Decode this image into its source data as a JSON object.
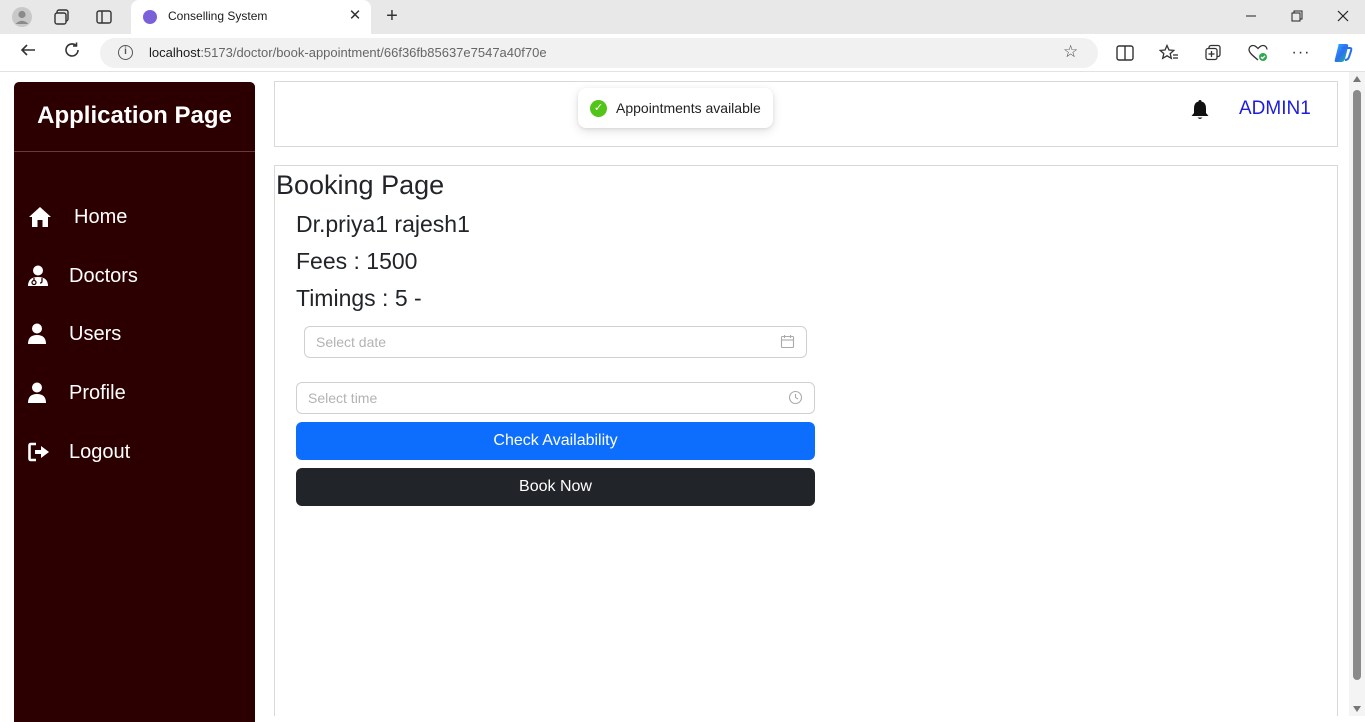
{
  "browser": {
    "tab_title": "Conselling System",
    "url_host": "localhost",
    "url_path": ":5173/doctor/book-appointment/66f36fb85637e7547a40f70e",
    "new_tab_symbol": "+",
    "close_tab_symbol": "✕"
  },
  "sidebar": {
    "title": "Application Page",
    "items": [
      {
        "label": "Home",
        "icon": "home-icon"
      },
      {
        "label": "Doctors",
        "icon": "doctor-icon"
      },
      {
        "label": "Users",
        "icon": "user-icon"
      },
      {
        "label": "Profile",
        "icon": "user-icon"
      },
      {
        "label": "Logout",
        "icon": "logout-icon"
      }
    ],
    "bg_color": "#2c0000"
  },
  "header": {
    "user_name": "ADMIN1"
  },
  "toast": {
    "message": "Appointments available",
    "status_color": "#52c41a"
  },
  "booking": {
    "page_title": "Booking Page",
    "doctor_name": "Dr.priya1 rajesh1",
    "fees": "Fees : 1500",
    "timings": "Timings : 5 -",
    "date_placeholder": "Select date",
    "time_placeholder": "Select time",
    "check_button": "Check Availability",
    "book_button": "Book Now",
    "primary_color": "#0d6efd",
    "dark_color": "#212529"
  }
}
